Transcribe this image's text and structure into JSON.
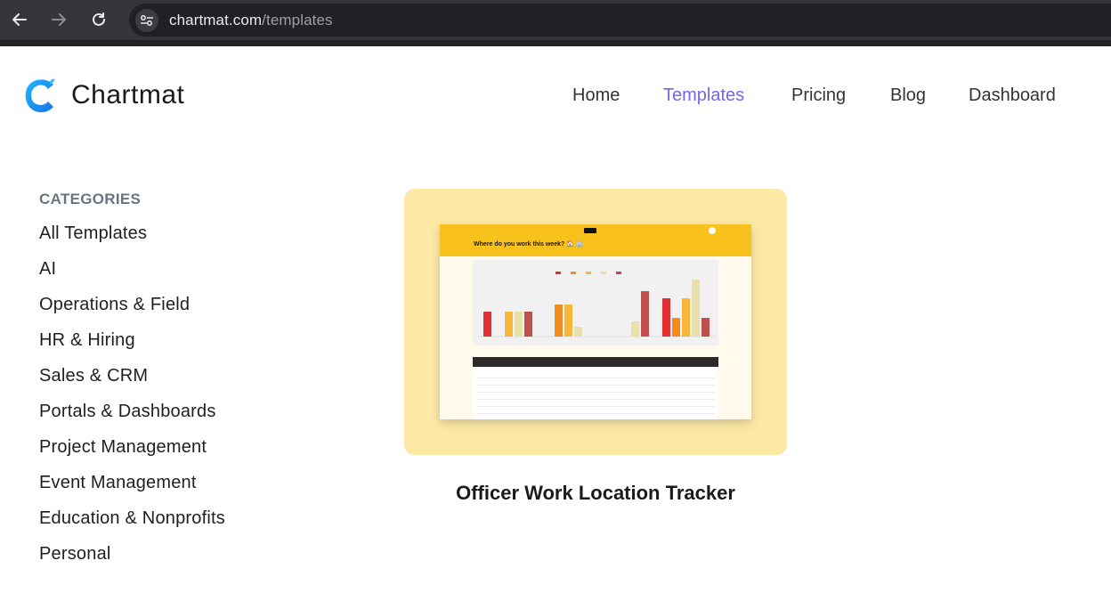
{
  "browser": {
    "url_host": "chartmat.com",
    "url_path": "/templates"
  },
  "site": {
    "brand": "Chartmat",
    "accent": "#7466e8",
    "nav": [
      {
        "label": "Home",
        "active": false
      },
      {
        "label": "Templates",
        "active": true
      },
      {
        "label": "Pricing",
        "active": false
      },
      {
        "label": "Blog",
        "active": false
      },
      {
        "label": "Dashboard",
        "active": false
      }
    ]
  },
  "sidebar": {
    "heading": "CATEGORIES",
    "items": [
      "All Templates",
      "AI",
      "Operations & Field",
      "HR & Hiring",
      "Sales & CRM",
      "Portals & Dashboards",
      "Project Management",
      "Event Management",
      "Education & Nonprofits",
      "Personal"
    ]
  },
  "templates": [
    {
      "title": "Officer Work Location Tracker",
      "preview_title": "Where do you work this week? 🏠 🏢",
      "card_color": "#fde8a6"
    }
  ]
}
